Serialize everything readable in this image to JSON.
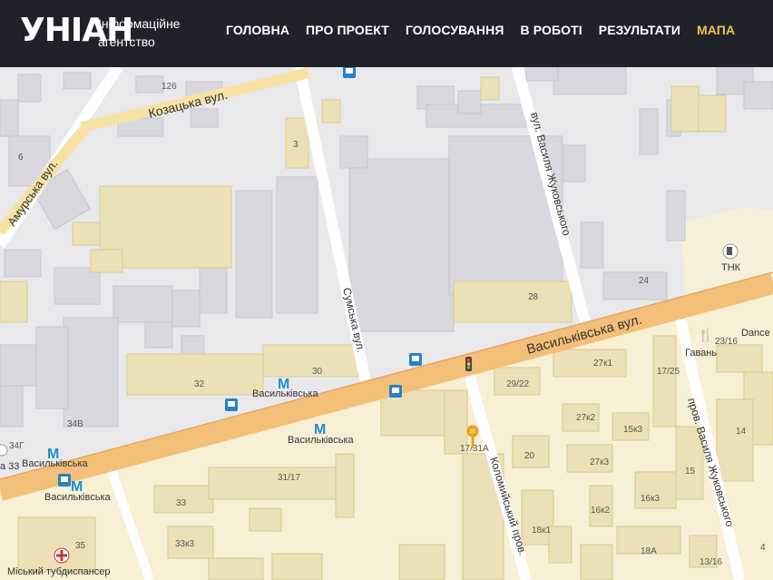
{
  "header": {
    "logo": "УНІАН",
    "tagline_line1": "Інформаційне",
    "tagline_line2": "агентство",
    "nav": [
      {
        "label": "ГОЛОВНА",
        "active": false
      },
      {
        "label": "ПРО ПРОЕКТ",
        "active": false
      },
      {
        "label": "ГОЛОСУВАННЯ",
        "active": false
      },
      {
        "label": "В РОБОТІ",
        "active": false
      },
      {
        "label": "РЕЗУЛЬТАТИ",
        "active": false
      },
      {
        "label": "МАПА",
        "active": true
      }
    ]
  },
  "map": {
    "colors": {
      "ground": "#e9e9ec",
      "residential": "#f7f0d4",
      "road_major": "#f3c07a",
      "road_minor": "#ffffff",
      "building": "#d8d8de",
      "building_res": "#ece1b6",
      "park": "#e3eec4",
      "accent": "#f2c14e"
    },
    "streets": {
      "kozatska": "Козацька вул.",
      "amurska": "Амурська вул.",
      "sumska": "Сумська вул.",
      "zhukovskoho_top": "вул. Василя Жуковського",
      "vasylkivska": "Васильківська вул.",
      "kolomyiskyi": "Коломийський пров.",
      "zhukovskoho_bottom": "пров. Василя Жуковського"
    },
    "metro": {
      "label1": "Васильківська",
      "label2": "Васильківська",
      "label3": "Васильківська",
      "label4": "Васильківська"
    },
    "poi": {
      "tnk": "ТНК",
      "havan": "Гавань",
      "dance": "Dance",
      "tubdispanser": "Міський тубдиспансер",
      "a33": "а 33"
    },
    "house_numbers": {
      "n126": "126",
      "n6": "6",
      "n3": "3",
      "n24": "24",
      "n28": "28",
      "n32": "32",
      "n30": "30",
      "n34v": "34В",
      "n34g": "34Г",
      "n29_22": "29/22",
      "n27k1": "27к1",
      "n17_25": "17/25",
      "n23_16": "23/16",
      "n14": "14",
      "n27k2": "27к2",
      "n15k3": "15к3",
      "n20": "20",
      "n27k3": "27к3",
      "n17_31a": "17/31А",
      "n31_17": "31/17",
      "n33": "33",
      "n15": "15",
      "n16k2": "16к2",
      "n16k3": "16к3",
      "n33k3": "33к3",
      "n18k1": "18к1",
      "n35": "35",
      "n18a": "18А",
      "n13_16": "13/16",
      "n4": "4"
    }
  }
}
